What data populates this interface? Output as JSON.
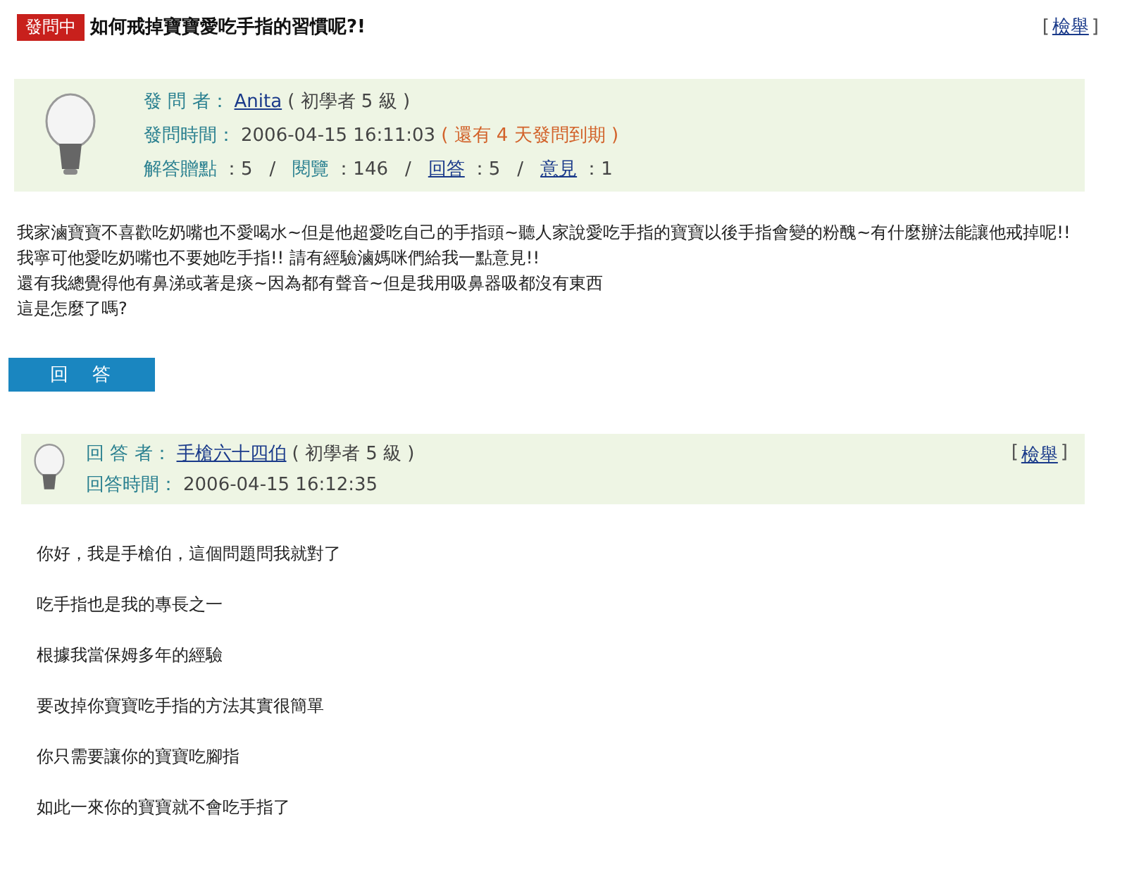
{
  "question": {
    "status": "發問中",
    "title": "如何戒掉寶寶愛吃手指的習慣呢?!",
    "report_open": "[",
    "report": "檢舉",
    "report_close": "]",
    "asker_label": "發 問 者：",
    "asker": "Anita",
    "asker_level": "( 初學者 5 級 )",
    "time_label": "發問時間：",
    "time": "2006-04-15 16:11:03",
    "remaining": "( 還有 4 天發問到期 )",
    "separator": "/",
    "stats": [
      {
        "label": "解答贈點",
        "value": "：5",
        "link": false
      },
      {
        "label": "閱覽",
        "value": "：146",
        "link": false
      },
      {
        "label": "回答",
        "value": "：5",
        "link": true
      },
      {
        "label": "意見",
        "value": "：1",
        "link": true
      }
    ],
    "body": [
      "我家滷寶寶不喜歡吃奶嘴也不愛喝水~但是他超愛吃自己的手指頭~聽人家說愛吃手指的寶寶以後手指會變的粉醜~有什麼辦法能讓他戒掉呢!! 我寧可他愛吃奶嘴也不要她吃手指!! 請有經驗滷媽咪們給我一點意見!!",
      "還有我總覺得他有鼻涕或著是痰~因為都有聲音~但是我用吸鼻器吸都沒有東西",
      "這是怎麼了嗎?"
    ]
  },
  "answer_button": "回　答",
  "answer": {
    "report_open": "[",
    "report": "檢舉",
    "report_close": "]",
    "answerer_label": "回 答 者：",
    "answerer": "手槍六十四伯",
    "answerer_level": "( 初學者 5 級 )",
    "time_label": "回答時間：",
    "time": "2006-04-15 16:12:35",
    "lines": [
      "你好，我是手槍伯，這個問題問我就對了",
      "吃手指也是我的專長之一",
      "根據我當保姆多年的經驗",
      "要改掉你寶寶吃手指的方法其實很簡單",
      "你只需要讓你的寶寶吃腳指",
      "如此一來你的寶寶就不會吃手指了"
    ]
  }
}
